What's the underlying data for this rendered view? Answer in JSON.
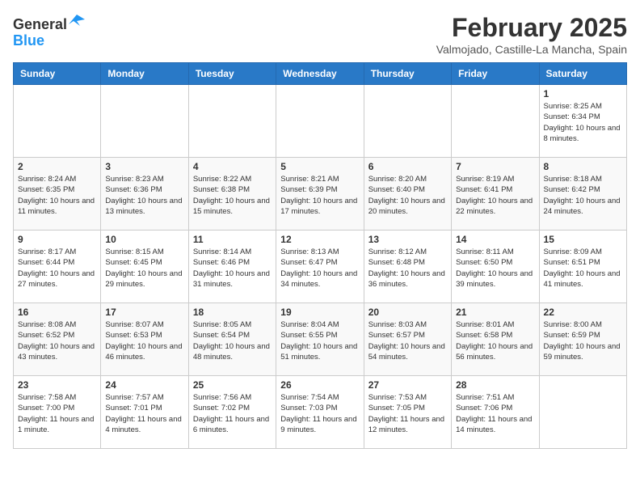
{
  "header": {
    "logo_line1": "General",
    "logo_line2": "Blue",
    "month": "February 2025",
    "location": "Valmojado, Castille-La Mancha, Spain"
  },
  "weekdays": [
    "Sunday",
    "Monday",
    "Tuesday",
    "Wednesday",
    "Thursday",
    "Friday",
    "Saturday"
  ],
  "weeks": [
    [
      {
        "day": "",
        "info": ""
      },
      {
        "day": "",
        "info": ""
      },
      {
        "day": "",
        "info": ""
      },
      {
        "day": "",
        "info": ""
      },
      {
        "day": "",
        "info": ""
      },
      {
        "day": "",
        "info": ""
      },
      {
        "day": "1",
        "info": "Sunrise: 8:25 AM\nSunset: 6:34 PM\nDaylight: 10 hours and 8 minutes."
      }
    ],
    [
      {
        "day": "2",
        "info": "Sunrise: 8:24 AM\nSunset: 6:35 PM\nDaylight: 10 hours and 11 minutes."
      },
      {
        "day": "3",
        "info": "Sunrise: 8:23 AM\nSunset: 6:36 PM\nDaylight: 10 hours and 13 minutes."
      },
      {
        "day": "4",
        "info": "Sunrise: 8:22 AM\nSunset: 6:38 PM\nDaylight: 10 hours and 15 minutes."
      },
      {
        "day": "5",
        "info": "Sunrise: 8:21 AM\nSunset: 6:39 PM\nDaylight: 10 hours and 17 minutes."
      },
      {
        "day": "6",
        "info": "Sunrise: 8:20 AM\nSunset: 6:40 PM\nDaylight: 10 hours and 20 minutes."
      },
      {
        "day": "7",
        "info": "Sunrise: 8:19 AM\nSunset: 6:41 PM\nDaylight: 10 hours and 22 minutes."
      },
      {
        "day": "8",
        "info": "Sunrise: 8:18 AM\nSunset: 6:42 PM\nDaylight: 10 hours and 24 minutes."
      }
    ],
    [
      {
        "day": "9",
        "info": "Sunrise: 8:17 AM\nSunset: 6:44 PM\nDaylight: 10 hours and 27 minutes."
      },
      {
        "day": "10",
        "info": "Sunrise: 8:15 AM\nSunset: 6:45 PM\nDaylight: 10 hours and 29 minutes."
      },
      {
        "day": "11",
        "info": "Sunrise: 8:14 AM\nSunset: 6:46 PM\nDaylight: 10 hours and 31 minutes."
      },
      {
        "day": "12",
        "info": "Sunrise: 8:13 AM\nSunset: 6:47 PM\nDaylight: 10 hours and 34 minutes."
      },
      {
        "day": "13",
        "info": "Sunrise: 8:12 AM\nSunset: 6:48 PM\nDaylight: 10 hours and 36 minutes."
      },
      {
        "day": "14",
        "info": "Sunrise: 8:11 AM\nSunset: 6:50 PM\nDaylight: 10 hours and 39 minutes."
      },
      {
        "day": "15",
        "info": "Sunrise: 8:09 AM\nSunset: 6:51 PM\nDaylight: 10 hours and 41 minutes."
      }
    ],
    [
      {
        "day": "16",
        "info": "Sunrise: 8:08 AM\nSunset: 6:52 PM\nDaylight: 10 hours and 43 minutes."
      },
      {
        "day": "17",
        "info": "Sunrise: 8:07 AM\nSunset: 6:53 PM\nDaylight: 10 hours and 46 minutes."
      },
      {
        "day": "18",
        "info": "Sunrise: 8:05 AM\nSunset: 6:54 PM\nDaylight: 10 hours and 48 minutes."
      },
      {
        "day": "19",
        "info": "Sunrise: 8:04 AM\nSunset: 6:55 PM\nDaylight: 10 hours and 51 minutes."
      },
      {
        "day": "20",
        "info": "Sunrise: 8:03 AM\nSunset: 6:57 PM\nDaylight: 10 hours and 54 minutes."
      },
      {
        "day": "21",
        "info": "Sunrise: 8:01 AM\nSunset: 6:58 PM\nDaylight: 10 hours and 56 minutes."
      },
      {
        "day": "22",
        "info": "Sunrise: 8:00 AM\nSunset: 6:59 PM\nDaylight: 10 hours and 59 minutes."
      }
    ],
    [
      {
        "day": "23",
        "info": "Sunrise: 7:58 AM\nSunset: 7:00 PM\nDaylight: 11 hours and 1 minute."
      },
      {
        "day": "24",
        "info": "Sunrise: 7:57 AM\nSunset: 7:01 PM\nDaylight: 11 hours and 4 minutes."
      },
      {
        "day": "25",
        "info": "Sunrise: 7:56 AM\nSunset: 7:02 PM\nDaylight: 11 hours and 6 minutes."
      },
      {
        "day": "26",
        "info": "Sunrise: 7:54 AM\nSunset: 7:03 PM\nDaylight: 11 hours and 9 minutes."
      },
      {
        "day": "27",
        "info": "Sunrise: 7:53 AM\nSunset: 7:05 PM\nDaylight: 11 hours and 12 minutes."
      },
      {
        "day": "28",
        "info": "Sunrise: 7:51 AM\nSunset: 7:06 PM\nDaylight: 11 hours and 14 minutes."
      },
      {
        "day": "",
        "info": ""
      }
    ]
  ]
}
